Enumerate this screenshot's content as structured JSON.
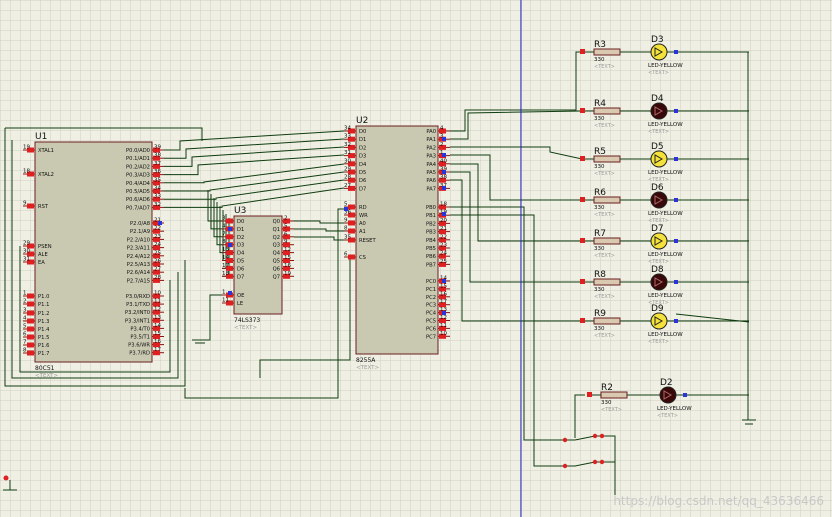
{
  "colors": {
    "grid": "#cfcfc2",
    "chip_fill": "#c9c9b2",
    "chip_stroke": "#6b1f1f",
    "wire": "#0f3d0f",
    "pin": "#8a1414",
    "pin_red": "#e02020",
    "pin_blue": "#2a34d8",
    "label": "#111111",
    "ref": "#111111",
    "ghost": "#9a9a9a",
    "resistor_fill": "#d9c9b0",
    "led_yellow": "#f4e23a",
    "led_dark": "#3a0808",
    "divider": "#2424c8"
  },
  "ghost_text": "<TEXT>",
  "u1": {
    "ref": "U1",
    "part": "80C51",
    "left_pins": [
      {
        "num": "19",
        "name": "XTAL1"
      },
      {
        "num": "18",
        "name": "XTAL2"
      },
      {
        "num": "9",
        "name": "RST"
      },
      {
        "num": "29",
        "name": "PSEN"
      },
      {
        "num": "30",
        "name": "ALE"
      },
      {
        "num": "31",
        "name": "EA"
      },
      {
        "num": "1",
        "name": "P1.0"
      },
      {
        "num": "2",
        "name": "P1.1"
      },
      {
        "num": "3",
        "name": "P1.2"
      },
      {
        "num": "4",
        "name": "P1.3"
      },
      {
        "num": "5",
        "name": "P1.4"
      },
      {
        "num": "6",
        "name": "P1.5"
      },
      {
        "num": "7",
        "name": "P1.6"
      },
      {
        "num": "8",
        "name": "P1.7"
      }
    ],
    "right_pins": [
      {
        "num": "39",
        "name": "P0.0/AD0"
      },
      {
        "num": "38",
        "name": "P0.1/AD1"
      },
      {
        "num": "37",
        "name": "P0.2/AD2"
      },
      {
        "num": "36",
        "name": "P0.3/AD3"
      },
      {
        "num": "35",
        "name": "P0.4/AD4"
      },
      {
        "num": "34",
        "name": "P0.5/AD5"
      },
      {
        "num": "33",
        "name": "P0.6/AD6"
      },
      {
        "num": "32",
        "name": "P0.7/AD7"
      },
      {
        "num": "21",
        "name": "P2.0/A8"
      },
      {
        "num": "22",
        "name": "P2.1/A9"
      },
      {
        "num": "23",
        "name": "P2.2/A10"
      },
      {
        "num": "24",
        "name": "P2.3/A11"
      },
      {
        "num": "25",
        "name": "P2.4/A12"
      },
      {
        "num": "26",
        "name": "P2.5/A13"
      },
      {
        "num": "27",
        "name": "P2.6/A14"
      },
      {
        "num": "28",
        "name": "P2.7/A15"
      },
      {
        "num": "10",
        "name": "P3.0/RXD"
      },
      {
        "num": "11",
        "name": "P3.1/TXD"
      },
      {
        "num": "12",
        "name": "P3.2/INT0"
      },
      {
        "num": "13",
        "name": "P3.3/INT1"
      },
      {
        "num": "14",
        "name": "P3.4/T0"
      },
      {
        "num": "15",
        "name": "P3.5/T1"
      },
      {
        "num": "16",
        "name": "P3.6/WR"
      },
      {
        "num": "17",
        "name": "P3.7/RD"
      }
    ]
  },
  "u3": {
    "ref": "U3",
    "part": "74LS373",
    "left_pins": [
      {
        "num": "3",
        "name": "D0"
      },
      {
        "num": "4",
        "name": "D1"
      },
      {
        "num": "7",
        "name": "D2"
      },
      {
        "num": "8",
        "name": "D3"
      },
      {
        "num": "13",
        "name": "D4"
      },
      {
        "num": "14",
        "name": "D5"
      },
      {
        "num": "17",
        "name": "D6"
      },
      {
        "num": "18",
        "name": "D7"
      },
      {
        "num": "1",
        "name": "OE"
      },
      {
        "num": "11",
        "name": "LE"
      }
    ],
    "right_pins": [
      {
        "num": "2",
        "name": "Q0"
      },
      {
        "num": "5",
        "name": "Q1"
      },
      {
        "num": "6",
        "name": "Q2"
      },
      {
        "num": "9",
        "name": "Q3"
      },
      {
        "num": "12",
        "name": "Q4"
      },
      {
        "num": "15",
        "name": "Q5"
      },
      {
        "num": "16",
        "name": "Q6"
      },
      {
        "num": "19",
        "name": "Q7"
      }
    ]
  },
  "u2": {
    "ref": "U2",
    "part": "8255A",
    "left_pins": [
      {
        "num": "34",
        "name": "D0"
      },
      {
        "num": "33",
        "name": "D1"
      },
      {
        "num": "32",
        "name": "D2"
      },
      {
        "num": "31",
        "name": "D3"
      },
      {
        "num": "30",
        "name": "D4"
      },
      {
        "num": "29",
        "name": "D5"
      },
      {
        "num": "28",
        "name": "D6"
      },
      {
        "num": "27",
        "name": "D7"
      },
      {
        "num": "5",
        "name": "RD"
      },
      {
        "num": "36",
        "name": "WR"
      },
      {
        "num": "9",
        "name": "A0"
      },
      {
        "num": "8",
        "name": "A1"
      },
      {
        "num": "35",
        "name": "RESET"
      },
      {
        "num": "6",
        "name": "CS"
      }
    ],
    "right_pins": [
      {
        "num": "4",
        "name": "PA0"
      },
      {
        "num": "3",
        "name": "PA1"
      },
      {
        "num": "2",
        "name": "PA2"
      },
      {
        "num": "1",
        "name": "PA3"
      },
      {
        "num": "40",
        "name": "PA4"
      },
      {
        "num": "39",
        "name": "PA5"
      },
      {
        "num": "38",
        "name": "PA6"
      },
      {
        "num": "37",
        "name": "PA7"
      },
      {
        "num": "18",
        "name": "PB0"
      },
      {
        "num": "19",
        "name": "PB1"
      },
      {
        "num": "20",
        "name": "PB2"
      },
      {
        "num": "21",
        "name": "PB3"
      },
      {
        "num": "22",
        "name": "PB4"
      },
      {
        "num": "23",
        "name": "PB5"
      },
      {
        "num": "24",
        "name": "PB6"
      },
      {
        "num": "25",
        "name": "PB7"
      },
      {
        "num": "14",
        "name": "PC0"
      },
      {
        "num": "15",
        "name": "PC1"
      },
      {
        "num": "16",
        "name": "PC2"
      },
      {
        "num": "17",
        "name": "PC3"
      },
      {
        "num": "13",
        "name": "PC4"
      },
      {
        "num": "12",
        "name": "PC5"
      },
      {
        "num": "11",
        "name": "PC6"
      },
      {
        "num": "10",
        "name": "PC7"
      }
    ]
  },
  "resistor_value": "330",
  "led_part": "LED-YELLOW",
  "led_rows": [
    {
      "r": "R3",
      "d": "D3",
      "lit": true
    },
    {
      "r": "R4",
      "d": "D4",
      "lit": false
    },
    {
      "r": "R5",
      "d": "D5",
      "lit": true
    },
    {
      "r": "R6",
      "d": "D6",
      "lit": false
    },
    {
      "r": "R7",
      "d": "D7",
      "lit": true
    },
    {
      "r": "R8",
      "d": "D8",
      "lit": false
    },
    {
      "r": "R9",
      "d": "D9",
      "lit": true
    }
  ],
  "extra_led": {
    "r": "R2",
    "d": "D2",
    "lit": false
  },
  "watermark": "https://blog.csdn.net/qq_43636466"
}
